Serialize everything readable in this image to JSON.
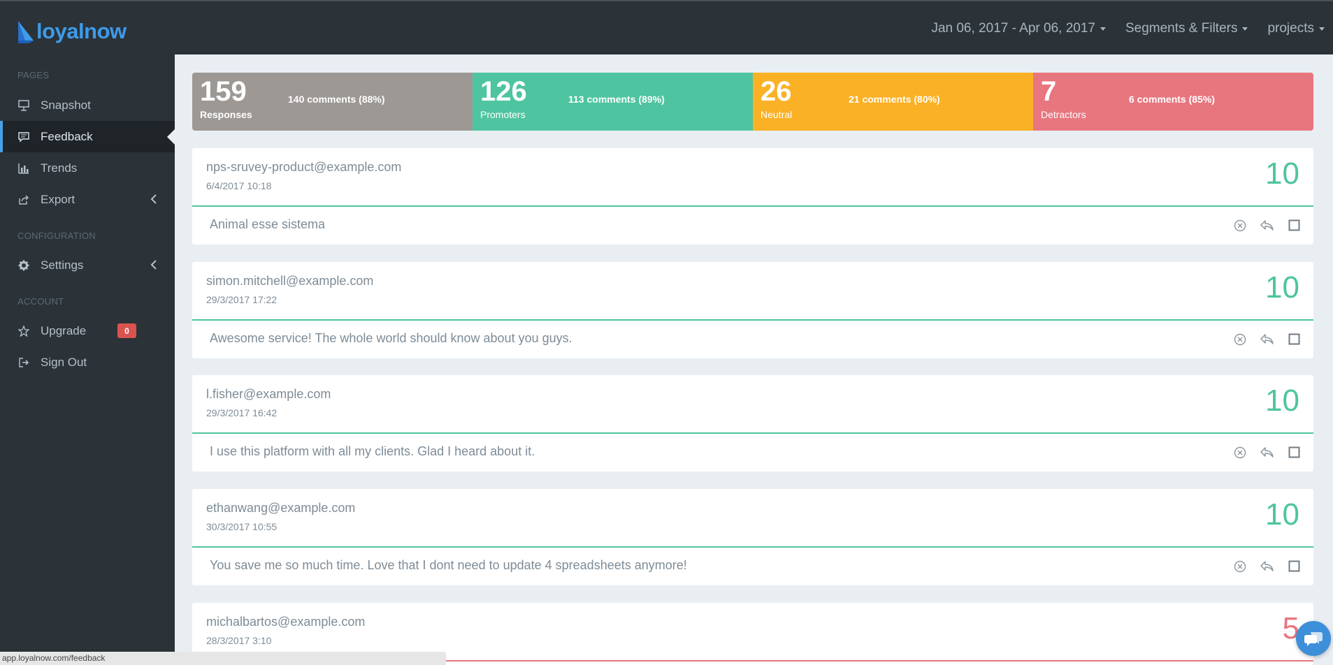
{
  "app": {
    "logo_text": "loyalnow",
    "brand_color": "#3d9be9"
  },
  "topnav": {
    "date_range": "Jan 06, 2017 - Apr 06, 2017",
    "segments": "Segments & Filters",
    "projects": "projects"
  },
  "sidebar": {
    "sections": {
      "pages": "PAGES",
      "configuration": "CONFIGURATION",
      "account": "ACCOUNT"
    },
    "items": {
      "snapshot": "Snapshot",
      "feedback": "Feedback",
      "trends": "Trends",
      "export": "Export",
      "settings": "Settings",
      "upgrade": "Upgrade",
      "upgrade_badge": "0",
      "signout": "Sign Out"
    },
    "active": "feedback"
  },
  "stats": {
    "responses": {
      "value": "159",
      "label": "Responses",
      "comments": "140 comments (88%)",
      "color": "#9d9894"
    },
    "promoters": {
      "value": "126",
      "label": "Promoters",
      "comments": "113 comments (89%)",
      "color": "#4ec4a0"
    },
    "neutral": {
      "value": "26",
      "label": "Neutral",
      "comments": "21 comments (80%)",
      "color": "#fbb125"
    },
    "detractors": {
      "value": "7",
      "label": "Detractors",
      "comments": "6 comments (85%)",
      "color": "#e8767f"
    }
  },
  "feedback": [
    {
      "email": "nps-sruvey-product@example.com",
      "date": "6/4/2017 10:18",
      "score": "10",
      "comment": "Animal esse sistema"
    },
    {
      "email": "simon.mitchell@example.com",
      "date": "29/3/2017 17:22",
      "score": "10",
      "comment": "Awesome service! The whole world should know about you guys."
    },
    {
      "email": "l.fisher@example.com",
      "date": "29/3/2017 16:42",
      "score": "10",
      "comment": "I use this platform with all my clients. Glad I heard about it."
    },
    {
      "email": "ethanwang@example.com",
      "date": "30/3/2017 10:55",
      "score": "10",
      "comment": "You save me so much time. Love that I dont need to update 4 spreadsheets anymore!"
    },
    {
      "email": "michalbartos@example.com",
      "date": "28/3/2017 3:10",
      "score": "5",
      "comment": ""
    }
  ],
  "statusbar": {
    "url": "app.loyalnow.com/feedback"
  },
  "icons": {
    "snapshot": "presentation-icon",
    "feedback": "comment-icon",
    "trends": "bar-chart-icon",
    "export": "share-icon",
    "settings": "gear-icon",
    "upgrade": "star-icon",
    "signout": "sign-out-icon",
    "dismiss": "close-circle-icon",
    "reply": "reply-icon",
    "select": "checkbox-icon",
    "chat": "chat-icon"
  },
  "colors": {
    "promoter": "#4ec4a0",
    "detractor": "#e8767f",
    "sidebar_bg": "#2b3238"
  }
}
